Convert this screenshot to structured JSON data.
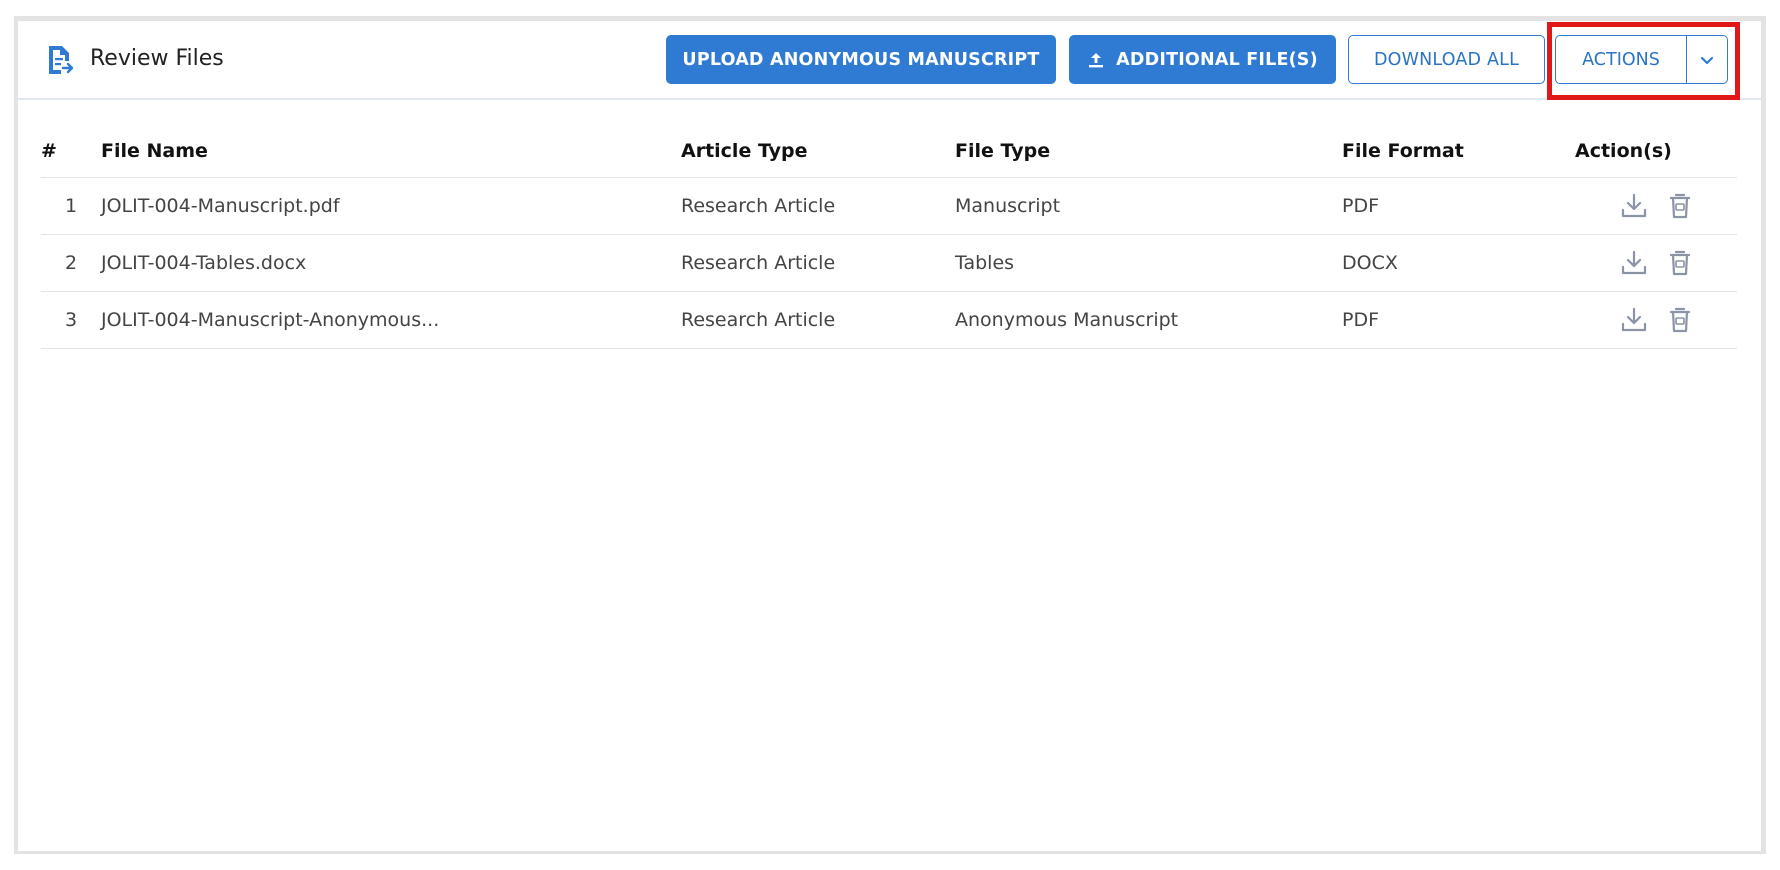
{
  "header": {
    "title": "Review Files",
    "upload_anonymous_label": "UPLOAD ANONYMOUS MANUSCRIPT",
    "additional_files_label": "ADDITIONAL FILE(S)",
    "download_all_label": "DOWNLOAD ALL",
    "actions_label": "ACTIONS"
  },
  "table": {
    "columns": [
      "#",
      "File Name",
      "Article Type",
      "File Type",
      "File Format",
      "Action(s)"
    ],
    "rows": [
      {
        "num": "1",
        "file_name": "JOLIT-004-Manuscript.pdf",
        "article_type": "Research Article",
        "file_type": "Manuscript",
        "file_format": "PDF"
      },
      {
        "num": "2",
        "file_name": "JOLIT-004-Tables.docx",
        "article_type": "Research Article",
        "file_type": "Tables",
        "file_format": "DOCX"
      },
      {
        "num": "3",
        "file_name": "JOLIT-004-Manuscript-Anonymous...",
        "article_type": "Research Article",
        "file_type": "Anonymous Manuscript",
        "file_format": "PDF"
      }
    ]
  },
  "colors": {
    "primary": "#2f7bd4",
    "highlight": "#e01818",
    "icon_gray": "#8a94a6"
  },
  "icons": {
    "title": "file-review-icon",
    "upload": "upload-icon",
    "caret": "chevron-down-icon",
    "row_download": "download-icon",
    "row_delete": "trash-icon"
  }
}
